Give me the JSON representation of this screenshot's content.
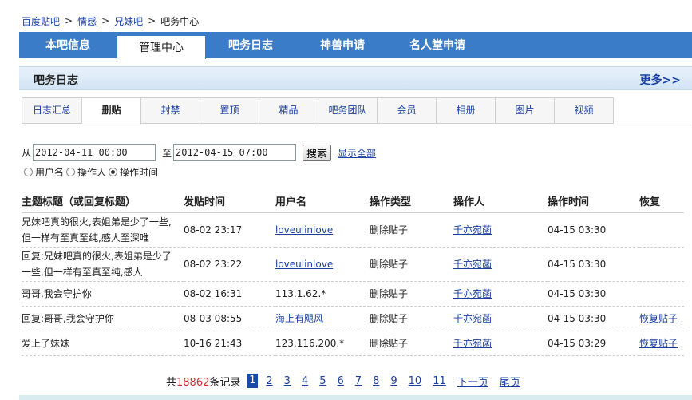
{
  "breadcrumb": {
    "items": [
      "百度贴吧",
      "情感",
      "兄妹吧"
    ],
    "current": "吧务中心",
    "sep": ">"
  },
  "main_tabs": [
    "本吧信息",
    "管理中心",
    "吧务日志",
    "神兽申请",
    "名人堂申请"
  ],
  "section": {
    "title": "吧务日志",
    "more": "更多>>"
  },
  "sub_tabs": [
    "日志汇总",
    "删贴",
    "封禁",
    "置顶",
    "精品",
    "吧务团队",
    "会员",
    "相册",
    "图片",
    "视频"
  ],
  "filter": {
    "from_label": "从",
    "from_value": "2012-04-11 00:00",
    "to_label": "至",
    "to_value": "2012-04-15 07:00",
    "search_label": "搜索",
    "show_all": "显示全部",
    "radio_options": [
      "用户名",
      "操作人",
      "操作时间"
    ]
  },
  "table": {
    "headers": [
      "主题标题（或回复标题）",
      "发贴时间",
      "用户名",
      "操作类型",
      "操作人",
      "操作时间",
      "恢复"
    ],
    "rows": [
      {
        "title": "兄妹吧真的很火,表姐弟是少了一些,但一样有至真至纯,感人至深唯",
        "post_time": "08-02 23:17",
        "user": "loveulinlove",
        "user_link": true,
        "op_type": "删除贴子",
        "operator": "千亦宛菡",
        "op_time": "04-15 03:30",
        "restore": ""
      },
      {
        "title": "回复:兄妹吧真的很火,表姐弟是少了一些,但一样有至真至纯,感人",
        "post_time": "08-02 23:22",
        "user": "loveulinlove",
        "user_link": true,
        "op_type": "删除贴子",
        "operator": "千亦宛菡",
        "op_time": "04-15 03:30",
        "restore": ""
      },
      {
        "title": "哥哥,我会守护你",
        "post_time": "08-02 16:31",
        "user": "113.1.62.*",
        "user_link": false,
        "op_type": "删除贴子",
        "operator": "千亦宛菡",
        "op_time": "04-15 03:30",
        "restore": ""
      },
      {
        "title": "回复:哥哥,我会守护你",
        "post_time": "08-03 08:55",
        "user": "海上有飓风",
        "user_link": true,
        "op_type": "删除贴子",
        "operator": "千亦宛菡",
        "op_time": "04-15 03:30",
        "restore": "恢复贴子"
      },
      {
        "title": "爱上了妹妹",
        "post_time": "10-16 21:43",
        "user": "123.116.200.*",
        "user_link": false,
        "op_type": "删除贴子",
        "operator": "千亦宛菡",
        "op_time": "04-15 03:29",
        "restore": "恢复贴子"
      }
    ]
  },
  "pager": {
    "prefix": "共",
    "count": "18862",
    "suffix": "条记录",
    "current": "1",
    "pages": [
      "2",
      "3",
      "4",
      "5",
      "6",
      "7",
      "8",
      "9",
      "10",
      "11"
    ],
    "next": "下一页",
    "last": "尾页"
  }
}
